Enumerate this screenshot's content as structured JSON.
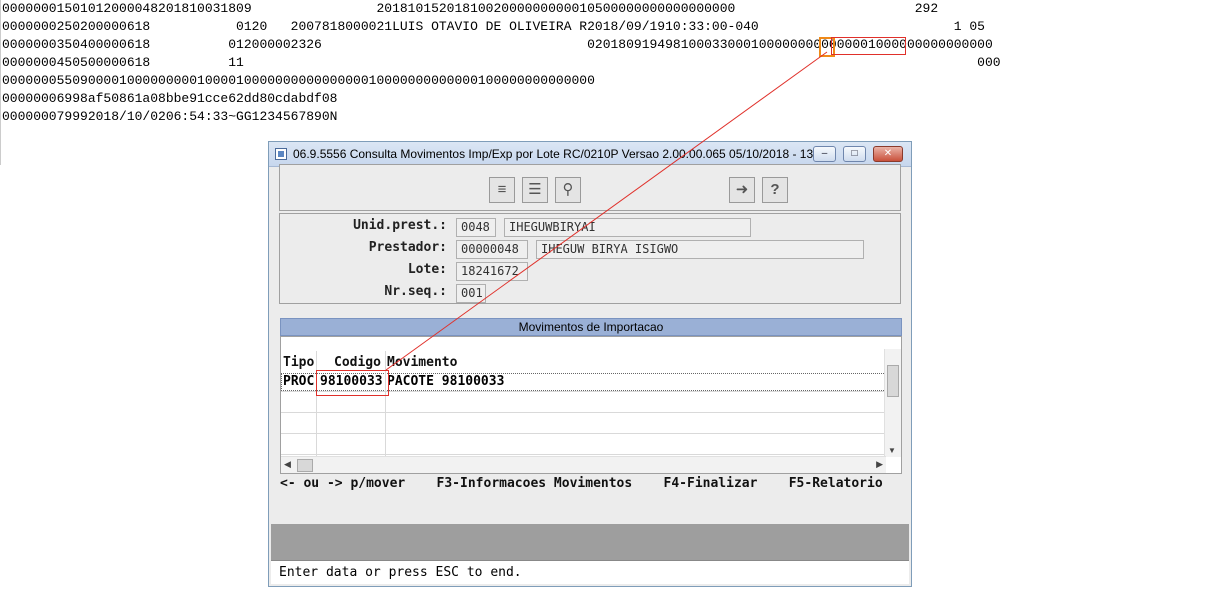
{
  "background_text": {
    "lines": [
      "00000001501012000048201810031809                2018101520181002000000000010500000000000000000                       292",
      "0000000250200000618           0120   2007818000021LUIS OTAVIO DE OLIVEIRA R2018/09/1910:33:00-040                         1 05",
      "0000000350400000618          012000002326                                  0201809194981000330001000000000000001000000000000000",
      "0000000450500000618          11                                                                                              000",
      "0000000550900001000000000100001000000000000000010000000000000100000000000000",
      "00000006998af50861a08bbe91cce62dd80cdabdf08",
      "000000079992018/10/0206:54:33~GG1234567890N"
    ]
  },
  "window": {
    "title": "06.9.5556 Consulta Movimentos Imp/Exp por Lote RC/0210P Versao 2.00.00.065 05/10/2018 - 13:52",
    "minimize_label": "–",
    "restore_label": "□",
    "close_label": "✕"
  },
  "toolbar": {
    "sort_icon": "≡",
    "list_icon": "☰",
    "search_icon": "⚲",
    "exit_icon": "➜",
    "help_icon": "?"
  },
  "form": {
    "unid_prest_label": "Unid.prest.:",
    "unid_prest_code": "0048",
    "unid_prest_name": "IHEGUWBIRYAI",
    "prestador_label": "Prestador:",
    "prestador_code": "00000048",
    "prestador_name": "IHEGUW BIRYA ISIGWO",
    "lote_label": "Lote:",
    "lote_value": "18241672",
    "nr_seq_label": "Nr.seq.:",
    "nr_seq_value": "001"
  },
  "grid": {
    "title": "Movimentos de Importacao",
    "columns": [
      "Tipo",
      "Codigo",
      "Movimento"
    ],
    "rows": [
      {
        "tipo": "PROC",
        "codigo": "98100033",
        "movimento": "PACOTE 98100033"
      }
    ]
  },
  "footer_keys": "<- ou -> p/mover    F3-Informacoes Movimentos    F4-Finalizar    F5-Relatorio",
  "status": "Enter data or press ESC to end.",
  "colors": {
    "highlight_red": "#e0302a",
    "highlight_orange": "#f08a18",
    "grid_header": "#9ab0d6"
  }
}
